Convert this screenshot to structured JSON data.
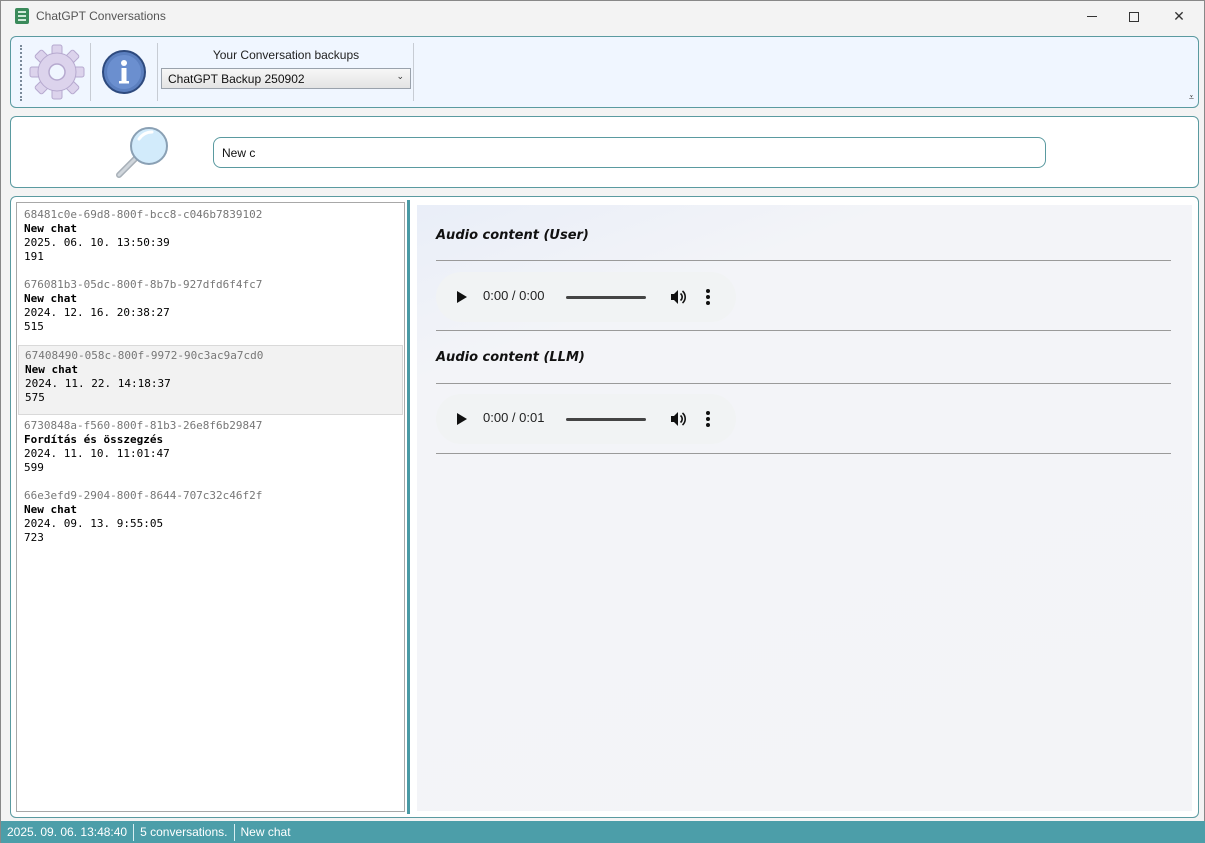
{
  "window": {
    "title": "ChatGPT Conversations"
  },
  "toolbar": {
    "settings_icon": "gear-icon",
    "info_icon": "info-icon",
    "backup_label": "Your Conversation backups",
    "backup_selected": "ChatGPT Backup 250902"
  },
  "search": {
    "icon": "magnifier-icon",
    "value": "New c"
  },
  "conversations": [
    {
      "id": "68481c0e-69d8-800f-bcc8-c046b7839102",
      "title": "New chat",
      "date": "2025. 06. 10. 13:50:39",
      "count": "191"
    },
    {
      "id": "676081b3-05dc-800f-8b7b-927dfd6f4fc7",
      "title": "New chat",
      "date": "2024. 12. 16. 20:38:27",
      "count": "515"
    },
    {
      "id": "67408490-058c-800f-9972-90c3ac9a7cd0",
      "title": "New chat",
      "date": "2024. 11. 22. 14:18:37",
      "count": "575"
    },
    {
      "id": "6730848a-f560-800f-81b3-26e8f6b29847",
      "title": "Fordítás és összegzés",
      "date": "2024. 11. 10. 11:01:47",
      "count": "599"
    },
    {
      "id": "66e3efd9-2904-800f-8644-707c32c46f2f",
      "title": "New chat",
      "date": "2024. 09. 13. 9:55:05",
      "count": "723"
    }
  ],
  "detail": {
    "user_heading": "Audio content (User)",
    "user_time": "0:00 / 0:00",
    "llm_heading": "Audio content (LLM)",
    "llm_time": "0:00 / 0:01"
  },
  "status": {
    "timestamp": "2025. 09. 06. 13:48:40",
    "count": "5 conversations.",
    "current": "New chat"
  },
  "colors": {
    "accent": "#4c9ea9",
    "panel_border": "#5a9aa0"
  }
}
